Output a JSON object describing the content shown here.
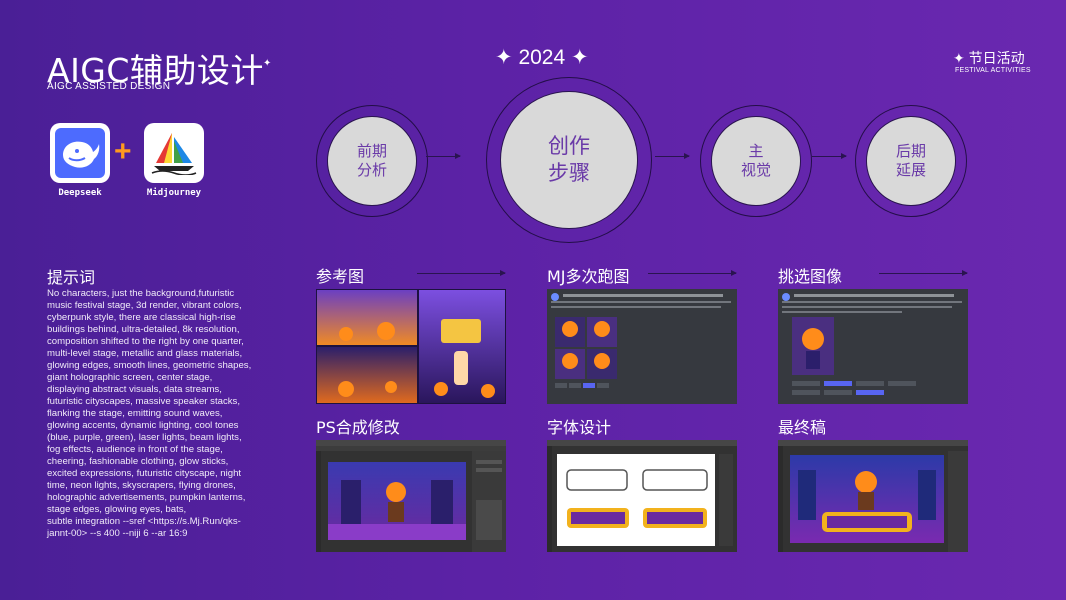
{
  "header": {
    "title": "AIGC辅助设计",
    "subtitle": "AIGC ASSISTED DESIGN",
    "year": "2024",
    "festival": "节日活动",
    "festival_sub": "FESTIVAL ACTIVITIES"
  },
  "logos": [
    {
      "name": "Deepseek"
    },
    {
      "name": "Midjourney"
    }
  ],
  "steps": [
    {
      "line1": "前期",
      "line2": "分析"
    },
    {
      "line1": "创作",
      "line2": "步骤"
    },
    {
      "line1": "主",
      "line2": "视觉"
    },
    {
      "line1": "后期",
      "line2": "延展"
    }
  ],
  "prompt": {
    "title": "提示词",
    "text": "No characters, just the background,futuristic\nmusic festival stage, 3d render, vibrant colors,\ncyberpunk style, there are classical high-rise\nbuildings behind, ultra-detailed, 8k resolution,\ncomposition shifted to the right by one quarter,\nmulti-level stage, metallic and glass materials,\nglowing edges, smooth lines, geometric shapes,\ngiant holographic screen, center stage,\ndisplaying abstract visuals, data streams,\nfuturistic cityscapes, massive speaker stacks,\nflanking the stage, emitting sound waves,\nglowing accents, dynamic lighting, cool tones\n(blue, purple, green), laser lights, beam lights,\nfog effects, audience in front of the stage,\ncheering, fashionable clothing, glow sticks,\nexcited expressions, futuristic cityscape, night\ntime, neon lights, skyscrapers, flying drones,\n holographic advertisements, pumpkin lanterns,\nstage edges, glowing eyes, bats,\nsubtle integration --sref <https://s.Mj.Run/qks-\njannt-00> --s 400 --niji 6 --ar 16:9"
  },
  "sections": [
    {
      "label": "参考图"
    },
    {
      "label": "MJ多次跑图"
    },
    {
      "label": "挑选图像"
    },
    {
      "label": "PS合成修改"
    },
    {
      "label": "字体设计"
    },
    {
      "label": "最终稿"
    }
  ],
  "colors": {
    "bg_start": "#4a1f96",
    "bg_end": "#6a28b0",
    "circle": "#d9d9d9",
    "circle_text": "#6a3aa8",
    "plus": "#ff9a1e"
  }
}
